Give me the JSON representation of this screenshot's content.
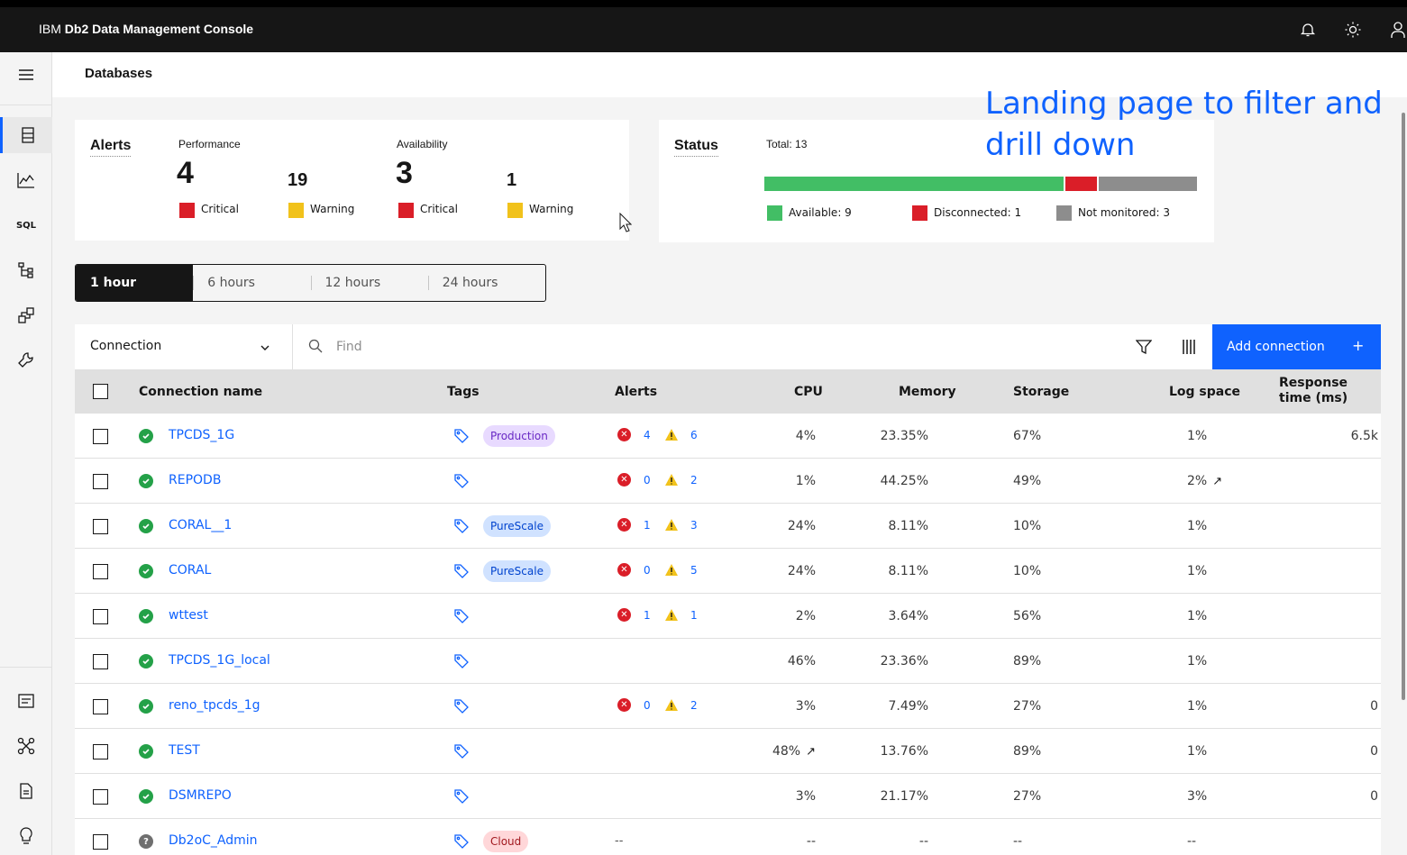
{
  "app": {
    "brand_prefix": "IBM",
    "brand_name": "Db2 Data Management Console"
  },
  "header_icons": [
    "notification-icon",
    "brightness-icon",
    "user-icon"
  ],
  "sidenav": {
    "top_icons": [
      "database-icon",
      "monitor-chart-icon",
      "sql-icon",
      "explain-tree-icon",
      "jobs-icon",
      "admin-wrench-icon"
    ],
    "bottom_icons": [
      "console-log-icon",
      "network-icon",
      "document-icon",
      "idea-bulb-icon"
    ]
  },
  "page": {
    "title": "Databases"
  },
  "annotation": "Landing page to filter and drill down",
  "alerts_card": {
    "title": "Alerts",
    "performance": {
      "label": "Performance",
      "critical": "4",
      "critical_label": "Critical",
      "warning": "19",
      "warning_label": "Warning"
    },
    "availability": {
      "label": "Availability",
      "critical": "3",
      "critical_label": "Critical",
      "warning": "1",
      "warning_label": "Warning"
    }
  },
  "status_card": {
    "title": "Status",
    "total": "Total: 13",
    "available": 9,
    "disconnected": 1,
    "not_monitored": 3,
    "available_label": "Available: 9",
    "disconnected_label": "Disconnected: 1",
    "not_monitored_label": "Not monitored: 3"
  },
  "time_ranges": [
    "1 hour",
    "6 hours",
    "12 hours",
    "24 hours"
  ],
  "selected_time_range": "1 hour",
  "toolbar": {
    "filter_by": "Connection",
    "search_placeholder": "Find",
    "add_label": "Add connection",
    "add_plus": "+"
  },
  "columns": {
    "name": "Connection name",
    "tags": "Tags",
    "alerts": "Alerts",
    "cpu": "CPU",
    "memory": "Memory",
    "storage": "Storage",
    "log_space": "Log space",
    "response_time": "Response time (ms)"
  },
  "colors": {
    "critical": "#da1e28",
    "warning": "#f1c21b",
    "available": "#42be65",
    "not_monitored": "#8d8d8d",
    "link": "#0f62fe"
  },
  "rows": [
    {
      "name": "TPCDS_1G",
      "status": "ok",
      "tag": "Production",
      "tag_kind": "purple",
      "crit": "4",
      "warn": "6",
      "cpu": "4%",
      "cpu_trend": "",
      "memory": "23.35%",
      "storage": "67%",
      "log": "1%",
      "log_trend": "",
      "resp": "6.5k"
    },
    {
      "name": "REPODB",
      "status": "ok",
      "tag": "",
      "tag_kind": "",
      "crit": "0",
      "warn": "2",
      "cpu": "1%",
      "cpu_trend": "",
      "memory": "44.25%",
      "storage": "49%",
      "log": "2%",
      "log_trend": "↗",
      "resp": ""
    },
    {
      "name": "CORAL__1",
      "status": "ok",
      "tag": "PureScale",
      "tag_kind": "blue",
      "crit": "1",
      "warn": "3",
      "cpu": "24%",
      "cpu_trend": "",
      "memory": "8.11%",
      "storage": "10%",
      "log": "1%",
      "log_trend": "",
      "resp": ""
    },
    {
      "name": "CORAL",
      "status": "ok",
      "tag": "PureScale",
      "tag_kind": "blue",
      "crit": "0",
      "warn": "5",
      "cpu": "24%",
      "cpu_trend": "",
      "memory": "8.11%",
      "storage": "10%",
      "log": "1%",
      "log_trend": "",
      "resp": ""
    },
    {
      "name": "wttest",
      "status": "ok",
      "tag": "",
      "tag_kind": "",
      "crit": "1",
      "warn": "1",
      "cpu": "2%",
      "cpu_trend": "",
      "memory": "3.64%",
      "storage": "56%",
      "log": "1%",
      "log_trend": "",
      "resp": ""
    },
    {
      "name": "TPCDS_1G_local",
      "status": "ok",
      "tag": "",
      "tag_kind": "",
      "crit": "",
      "warn": "",
      "cpu": "46%",
      "cpu_trend": "",
      "memory": "23.36%",
      "storage": "89%",
      "log": "1%",
      "log_trend": "",
      "resp": ""
    },
    {
      "name": "reno_tpcds_1g",
      "status": "ok",
      "tag": "",
      "tag_kind": "",
      "crit": "0",
      "warn": "2",
      "cpu": "3%",
      "cpu_trend": "",
      "memory": "7.49%",
      "storage": "27%",
      "log": "1%",
      "log_trend": "",
      "resp": "0"
    },
    {
      "name": "TEST",
      "status": "ok",
      "tag": "",
      "tag_kind": "",
      "crit": "",
      "warn": "",
      "cpu": "48%",
      "cpu_trend": "↗",
      "memory": "13.76%",
      "storage": "89%",
      "log": "1%",
      "log_trend": "",
      "resp": "0"
    },
    {
      "name": "DSMREPO",
      "status": "ok",
      "tag": "",
      "tag_kind": "",
      "crit": "",
      "warn": "",
      "cpu": "3%",
      "cpu_trend": "",
      "memory": "21.17%",
      "storage": "27%",
      "log": "3%",
      "log_trend": "",
      "resp": "0"
    },
    {
      "name": "Db2oC_Admin",
      "status": "unknown",
      "tag": "Cloud",
      "tag_kind": "red",
      "crit": "",
      "warn": "",
      "alerts_dash": "--",
      "cpu": "--",
      "cpu_trend": "",
      "memory": "--",
      "storage": "--",
      "log": "--",
      "log_trend": "",
      "resp": ""
    }
  ]
}
